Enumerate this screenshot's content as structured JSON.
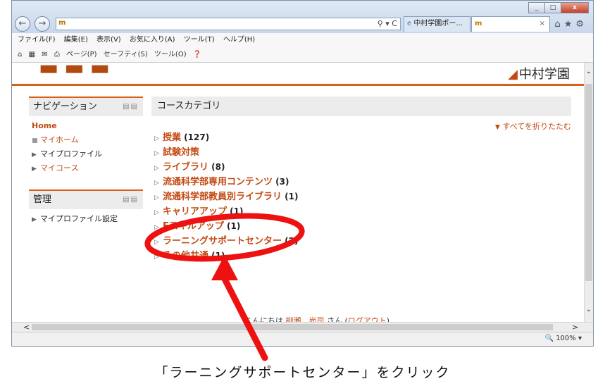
{
  "browser": {
    "address": "",
    "tabs": [
      {
        "label": "中村学園ポー..."
      },
      {
        "label": ""
      }
    ],
    "tab_close": "×",
    "window_buttons": [
      "_",
      "□",
      "x"
    ],
    "menu": [
      "ファイル(F)",
      "編集(E)",
      "表示(V)",
      "お気に入り(A)",
      "ツール(T)",
      "ヘルプ(H)"
    ],
    "commands": [
      "ページ(P)",
      "セーフティ(S)",
      "ツール(O)"
    ],
    "zoom": "100%"
  },
  "site": {
    "brand_right": "中村学園"
  },
  "navigation": {
    "title": "ナビゲーション",
    "home": "Home",
    "items": [
      {
        "label": "マイホーム"
      },
      {
        "label": "マイプロファイル"
      },
      {
        "label": "マイコース"
      }
    ]
  },
  "admin": {
    "title": "管理",
    "items": [
      {
        "label": "マイプロファイル設定"
      }
    ]
  },
  "main": {
    "title": "コースカテゴリ",
    "collapse_all": "すべてを折りたたむ",
    "categories": [
      {
        "name": "授業",
        "count": "(127)"
      },
      {
        "name": "試験対策",
        "count": ""
      },
      {
        "name": "ライブラリ",
        "count": "(8)"
      },
      {
        "name": "流通科学部専用コンテンツ",
        "count": "(3)"
      },
      {
        "name": "流通科学部教員別ライブラリ",
        "count": "(1)"
      },
      {
        "name": "キャリアアップ",
        "count": "(1)"
      },
      {
        "name": "Eスキルアップ",
        "count": "(1)"
      },
      {
        "name": "ラーニングサポートセンター",
        "count": "(2)"
      },
      {
        "name": "その他共通",
        "count": "(1)"
      }
    ],
    "login_prefix": "こんにちは",
    "login_name": "柳瀬　尚司",
    "login_suffix": "さん (",
    "logout": "ログアウト",
    "login_end": ")"
  },
  "annotation": {
    "caption": "「ラーニングサポートセンター」をクリック",
    "color": "#ee1111"
  }
}
